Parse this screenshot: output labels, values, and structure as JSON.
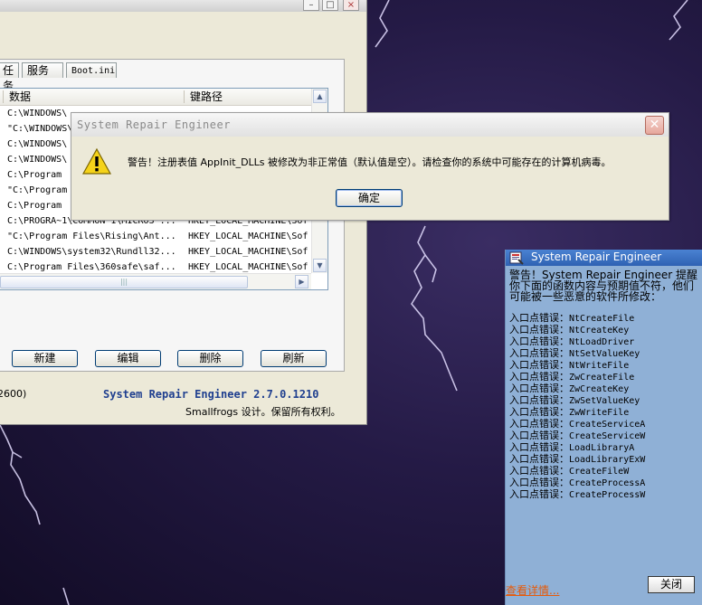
{
  "main_window": {
    "tabs": [
      "任务",
      "服务",
      "Boot.ini"
    ],
    "columns": {
      "data": "数据",
      "key_path": "键路径"
    },
    "rows": [
      {
        "data": "C:\\WINDOWS\\",
        "key": ""
      },
      {
        "data": "\"C:\\WINDOWS\\",
        "key": ""
      },
      {
        "data": "C:\\WINDOWS\\",
        "key": ""
      },
      {
        "data": "C:\\WINDOWS\\",
        "key": ""
      },
      {
        "data": "C:\\Program",
        "key": ""
      },
      {
        "data": "\"C:\\Program",
        "key": ""
      },
      {
        "data": "C:\\Program",
        "key": ""
      },
      {
        "data": "C:\\PROGRA~1\\COMMON 1\\MICROS ...",
        "key": "HKEY_LOCAL_MACHINE\\Sof"
      },
      {
        "data": "\"C:\\Program Files\\Rising\\Ant...",
        "key": "HKEY_LOCAL_MACHINE\\Sof"
      },
      {
        "data": "C:\\WINDOWS\\system32\\Rundll32...",
        "key": "HKEY_LOCAL_MACHINE\\Sof"
      },
      {
        "data": "C:\\Program Files\\360safe\\saf...",
        "key": "HKEY_LOCAL_MACHINE\\Sof"
      }
    ],
    "buttons": {
      "new": "新建",
      "edit": "编辑",
      "delete": "删除",
      "refresh": "刷新"
    },
    "status_left": "2600)",
    "version": "System Repair Engineer 2.7.0.1210",
    "copyright": "Smallfrogs 设计。保留所有权利。"
  },
  "dialog": {
    "title": "System Repair Engineer",
    "message": "警告！注册表值 AppInit_DLLs 被修改为非正常值（默认值是空）。请检查你的系统中可能存在的计算机病毒。",
    "ok_label": "确定",
    "close_glyph": "✕",
    "icon": "warning-icon"
  },
  "notification": {
    "title": "System Repair Engineer",
    "intro": "警告！System Repair Engineer 提醒你下面的函数内容与预期值不符，他们可能被一些恶意的软件所修改：",
    "entry_prefix": "入口点错误：",
    "entries": [
      "NtCreateFile",
      "NtCreateKey",
      "NtLoadDriver",
      "NtSetValueKey",
      "NtWriteFile",
      "ZwCreateFile",
      "ZwCreateKey",
      "ZwSetValueKey",
      "ZwWriteFile",
      "CreateServiceA",
      "CreateServiceW",
      "LoadLibraryA",
      "LoadLibraryExW",
      "CreateFileW",
      "CreateProcessA",
      "CreateProcessW"
    ],
    "details_link": "查看详情...",
    "close_label": "关闭"
  },
  "colors": {
    "desktop": "#241a45",
    "version_text": "#1f3f8f",
    "notify_bg": "#8fb0d6",
    "link": "#e65a0a"
  }
}
